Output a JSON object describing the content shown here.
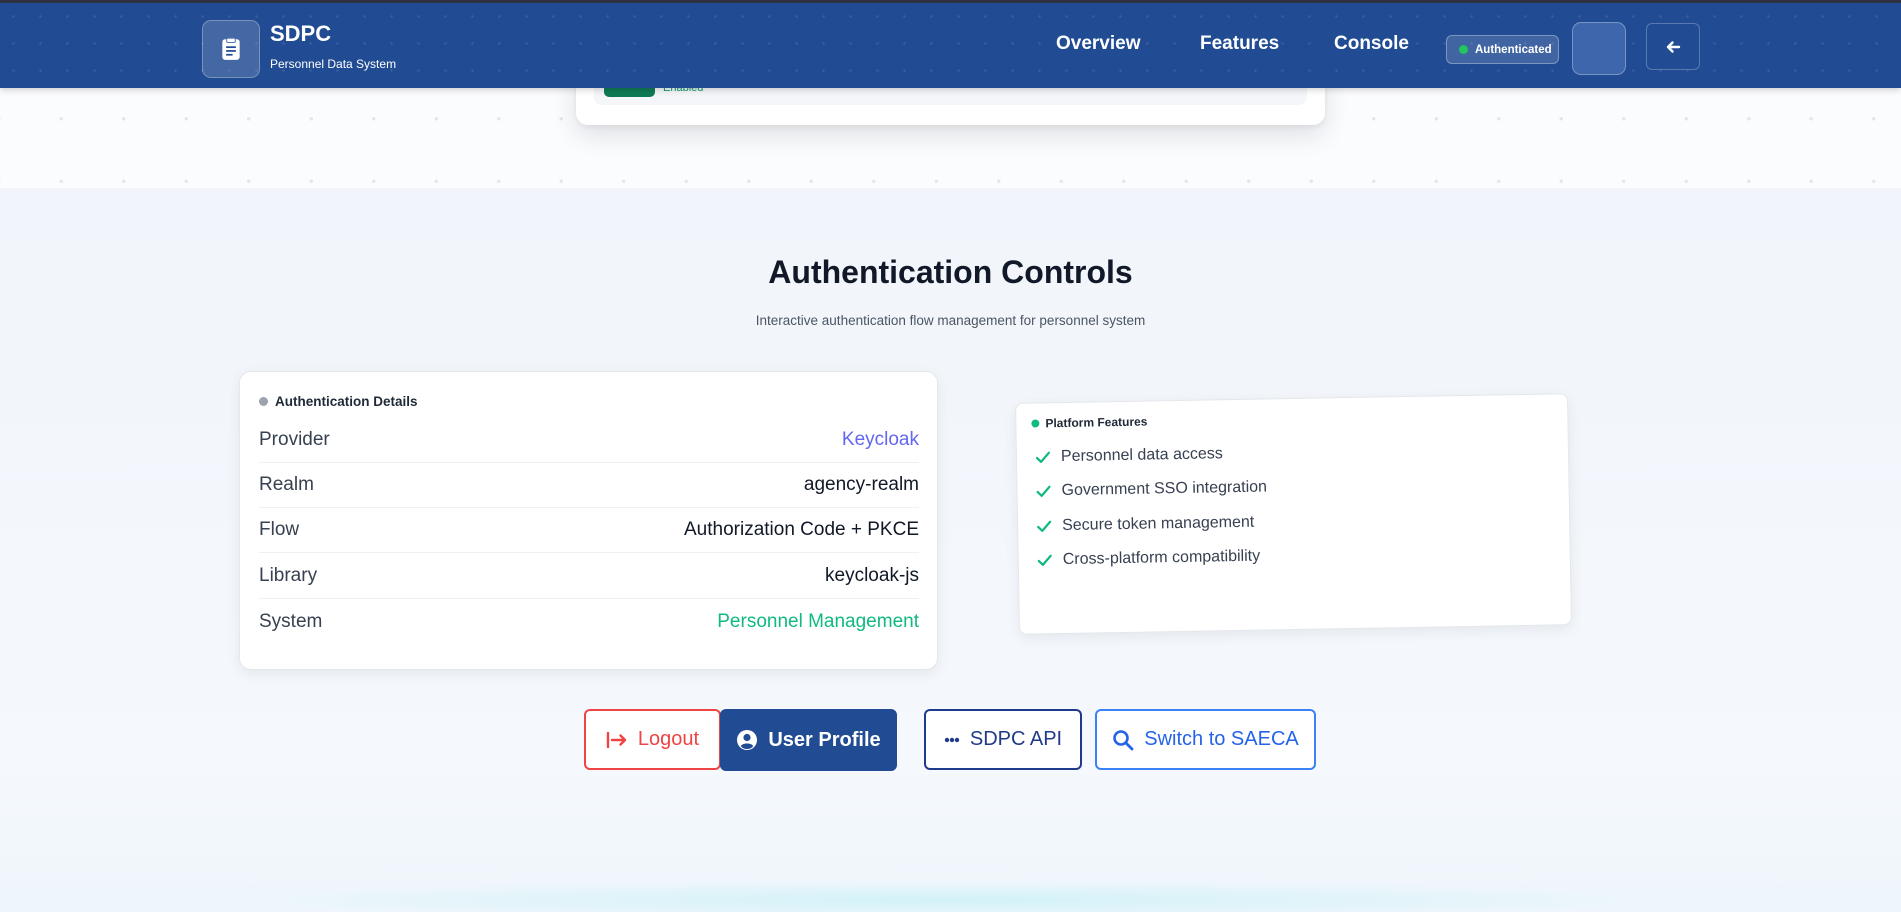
{
  "header": {
    "brand_title": "SDPC",
    "brand_subtitle": "Personnel Data System",
    "nav": [
      {
        "label": "Overview"
      },
      {
        "label": "Features"
      },
      {
        "label": "Console"
      }
    ],
    "auth_badge": "Authenticated"
  },
  "top_card": {
    "status_text": "Enabled"
  },
  "section": {
    "title": "Authentication Controls",
    "subtitle": "Interactive authentication flow management for personnel system"
  },
  "details": {
    "header": "Authentication Details",
    "rows": [
      {
        "label": "Provider",
        "value": "Keycloak",
        "color": "#6366f1"
      },
      {
        "label": "Realm",
        "value": "agency-realm",
        "color": "#111827"
      },
      {
        "label": "Flow",
        "value": "Authorization Code + PKCE",
        "color": "#111827"
      },
      {
        "label": "Library",
        "value": "keycloak-js",
        "color": "#111827"
      },
      {
        "label": "System",
        "value": "Personnel Management",
        "color": "#10b981"
      }
    ]
  },
  "features": {
    "header": "Platform Features",
    "items": [
      "Personnel data access",
      "Government SSO integration",
      "Secure token management",
      "Cross-platform compatibility"
    ]
  },
  "actions": {
    "logout": "Logout",
    "profile": "User Profile",
    "api": "SDPC API",
    "switch": "Switch to SAECA"
  },
  "colors": {
    "header_bg": "#214c93",
    "accent_red": "#ef4444",
    "accent_blue": "#3b82f6",
    "success_green": "#10b981",
    "provider_purple": "#6366f1"
  }
}
